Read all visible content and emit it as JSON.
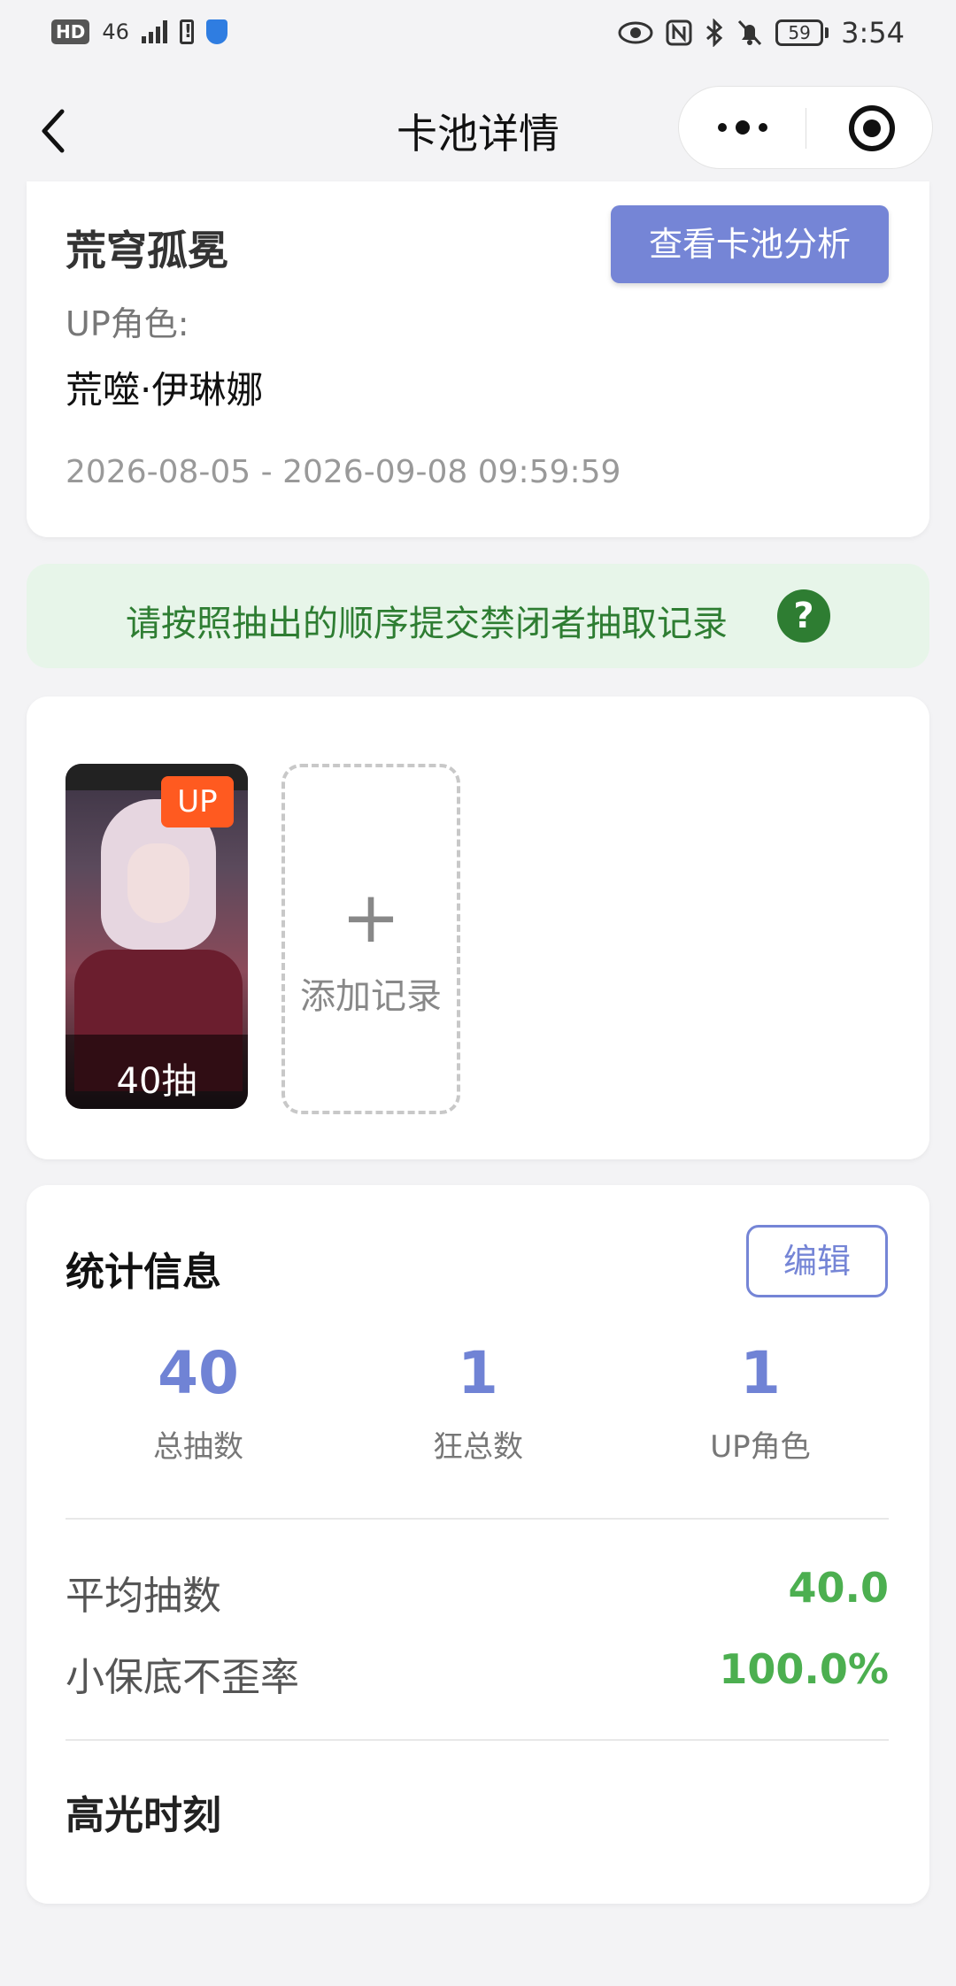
{
  "status_bar": {
    "left_badges": [
      "HD",
      "46"
    ],
    "battery": "59",
    "time": "3:54"
  },
  "nav": {
    "title": "卡池详情"
  },
  "pool": {
    "name": "荒穹孤冕",
    "analysis_button": "查看卡池分析",
    "up_label": "UP角色:",
    "up_character": "荒噬·伊琳娜",
    "date_range": "2026-08-05 - 2026-09-08 09:59:59"
  },
  "notice": {
    "text": "请按照抽出的顺序提交禁闭者抽取记录",
    "help_glyph": "?"
  },
  "records": [
    {
      "badge": "UP",
      "pulls": "40抽",
      "portrait_icon": "character-portrait-image"
    }
  ],
  "add_record": {
    "plus": "+",
    "label": "添加记录"
  },
  "stats": {
    "title": "统计信息",
    "edit_button": "编辑",
    "items": [
      {
        "value": "40",
        "label": "总抽数"
      },
      {
        "value": "1",
        "label": "狂总数"
      },
      {
        "value": "1",
        "label": "UP角色"
      }
    ],
    "avg_label": "平均抽数",
    "avg_value": "40.0",
    "rate_label": "小保底不歪率",
    "rate_value": "100.0%",
    "highlight_title": "高光时刻"
  },
  "colors": {
    "accent": "#7585d6",
    "success": "#4caf50",
    "notice_bg": "#e7f5e9",
    "badge": "#ff5a20"
  }
}
